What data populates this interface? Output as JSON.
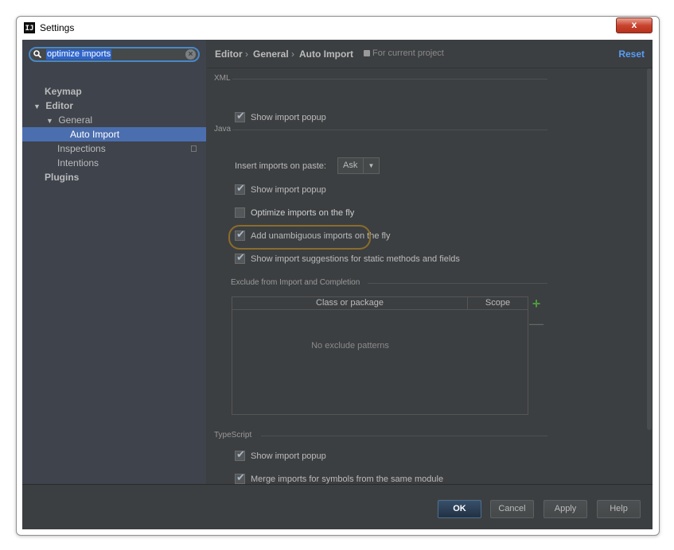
{
  "window": {
    "icon_text": "IJ",
    "title": "Settings",
    "close_glyph": "x"
  },
  "sidebar": {
    "search": {
      "value": "optimize imports",
      "clear_glyph": "×"
    },
    "items": [
      {
        "label": "Keymap",
        "arrow": ""
      },
      {
        "label": "Editor",
        "arrow": "▼"
      },
      {
        "label": "General",
        "arrow": "▼"
      },
      {
        "label": "Auto Import",
        "arrow": ""
      },
      {
        "label": "Inspections",
        "arrow": ""
      },
      {
        "label": "Intentions",
        "arrow": ""
      },
      {
        "label": "Plugins",
        "arrow": ""
      }
    ]
  },
  "breadcrumb": {
    "items": [
      "Editor",
      "General",
      "Auto Import"
    ],
    "separator": "›",
    "scope": "For current project",
    "reset": "Reset"
  },
  "sections": {
    "xml": {
      "title": "XML",
      "show_import_popup": {
        "label": "Show import popup",
        "checked": true
      }
    },
    "java": {
      "title": "Java",
      "insert_imports_label": "Insert imports on paste:",
      "insert_imports_value": "Ask",
      "show_import_popup": {
        "label": "Show import popup",
        "checked": true
      },
      "optimize_on_fly": {
        "label": "Optimize imports on the fly",
        "checked": false
      },
      "add_unambiguous": {
        "label": "Add unambiguous imports on the fly",
        "checked": true
      },
      "static_suggestions": {
        "label": "Show import suggestions for static methods and fields",
        "checked": true
      }
    },
    "exclude": {
      "title": "Exclude from Import and Completion",
      "columns": [
        "Class or package",
        "Scope"
      ],
      "empty_text": "No exclude patterns",
      "add_glyph": "+",
      "remove_glyph": "—"
    },
    "typescript": {
      "title": "TypeScript",
      "show_import_popup": {
        "label": "Show import popup",
        "checked": true
      },
      "merge_imports": {
        "label": "Merge imports for symbols from the same module",
        "checked": true
      }
    }
  },
  "buttons": {
    "ok": "OK",
    "cancel": "Cancel",
    "apply": "Apply",
    "help": "Help"
  },
  "colors": {
    "selection": "#4b6eaf",
    "link": "#589df6",
    "highlight_ring": "#8a6c2c",
    "add": "#4e9a3d"
  }
}
